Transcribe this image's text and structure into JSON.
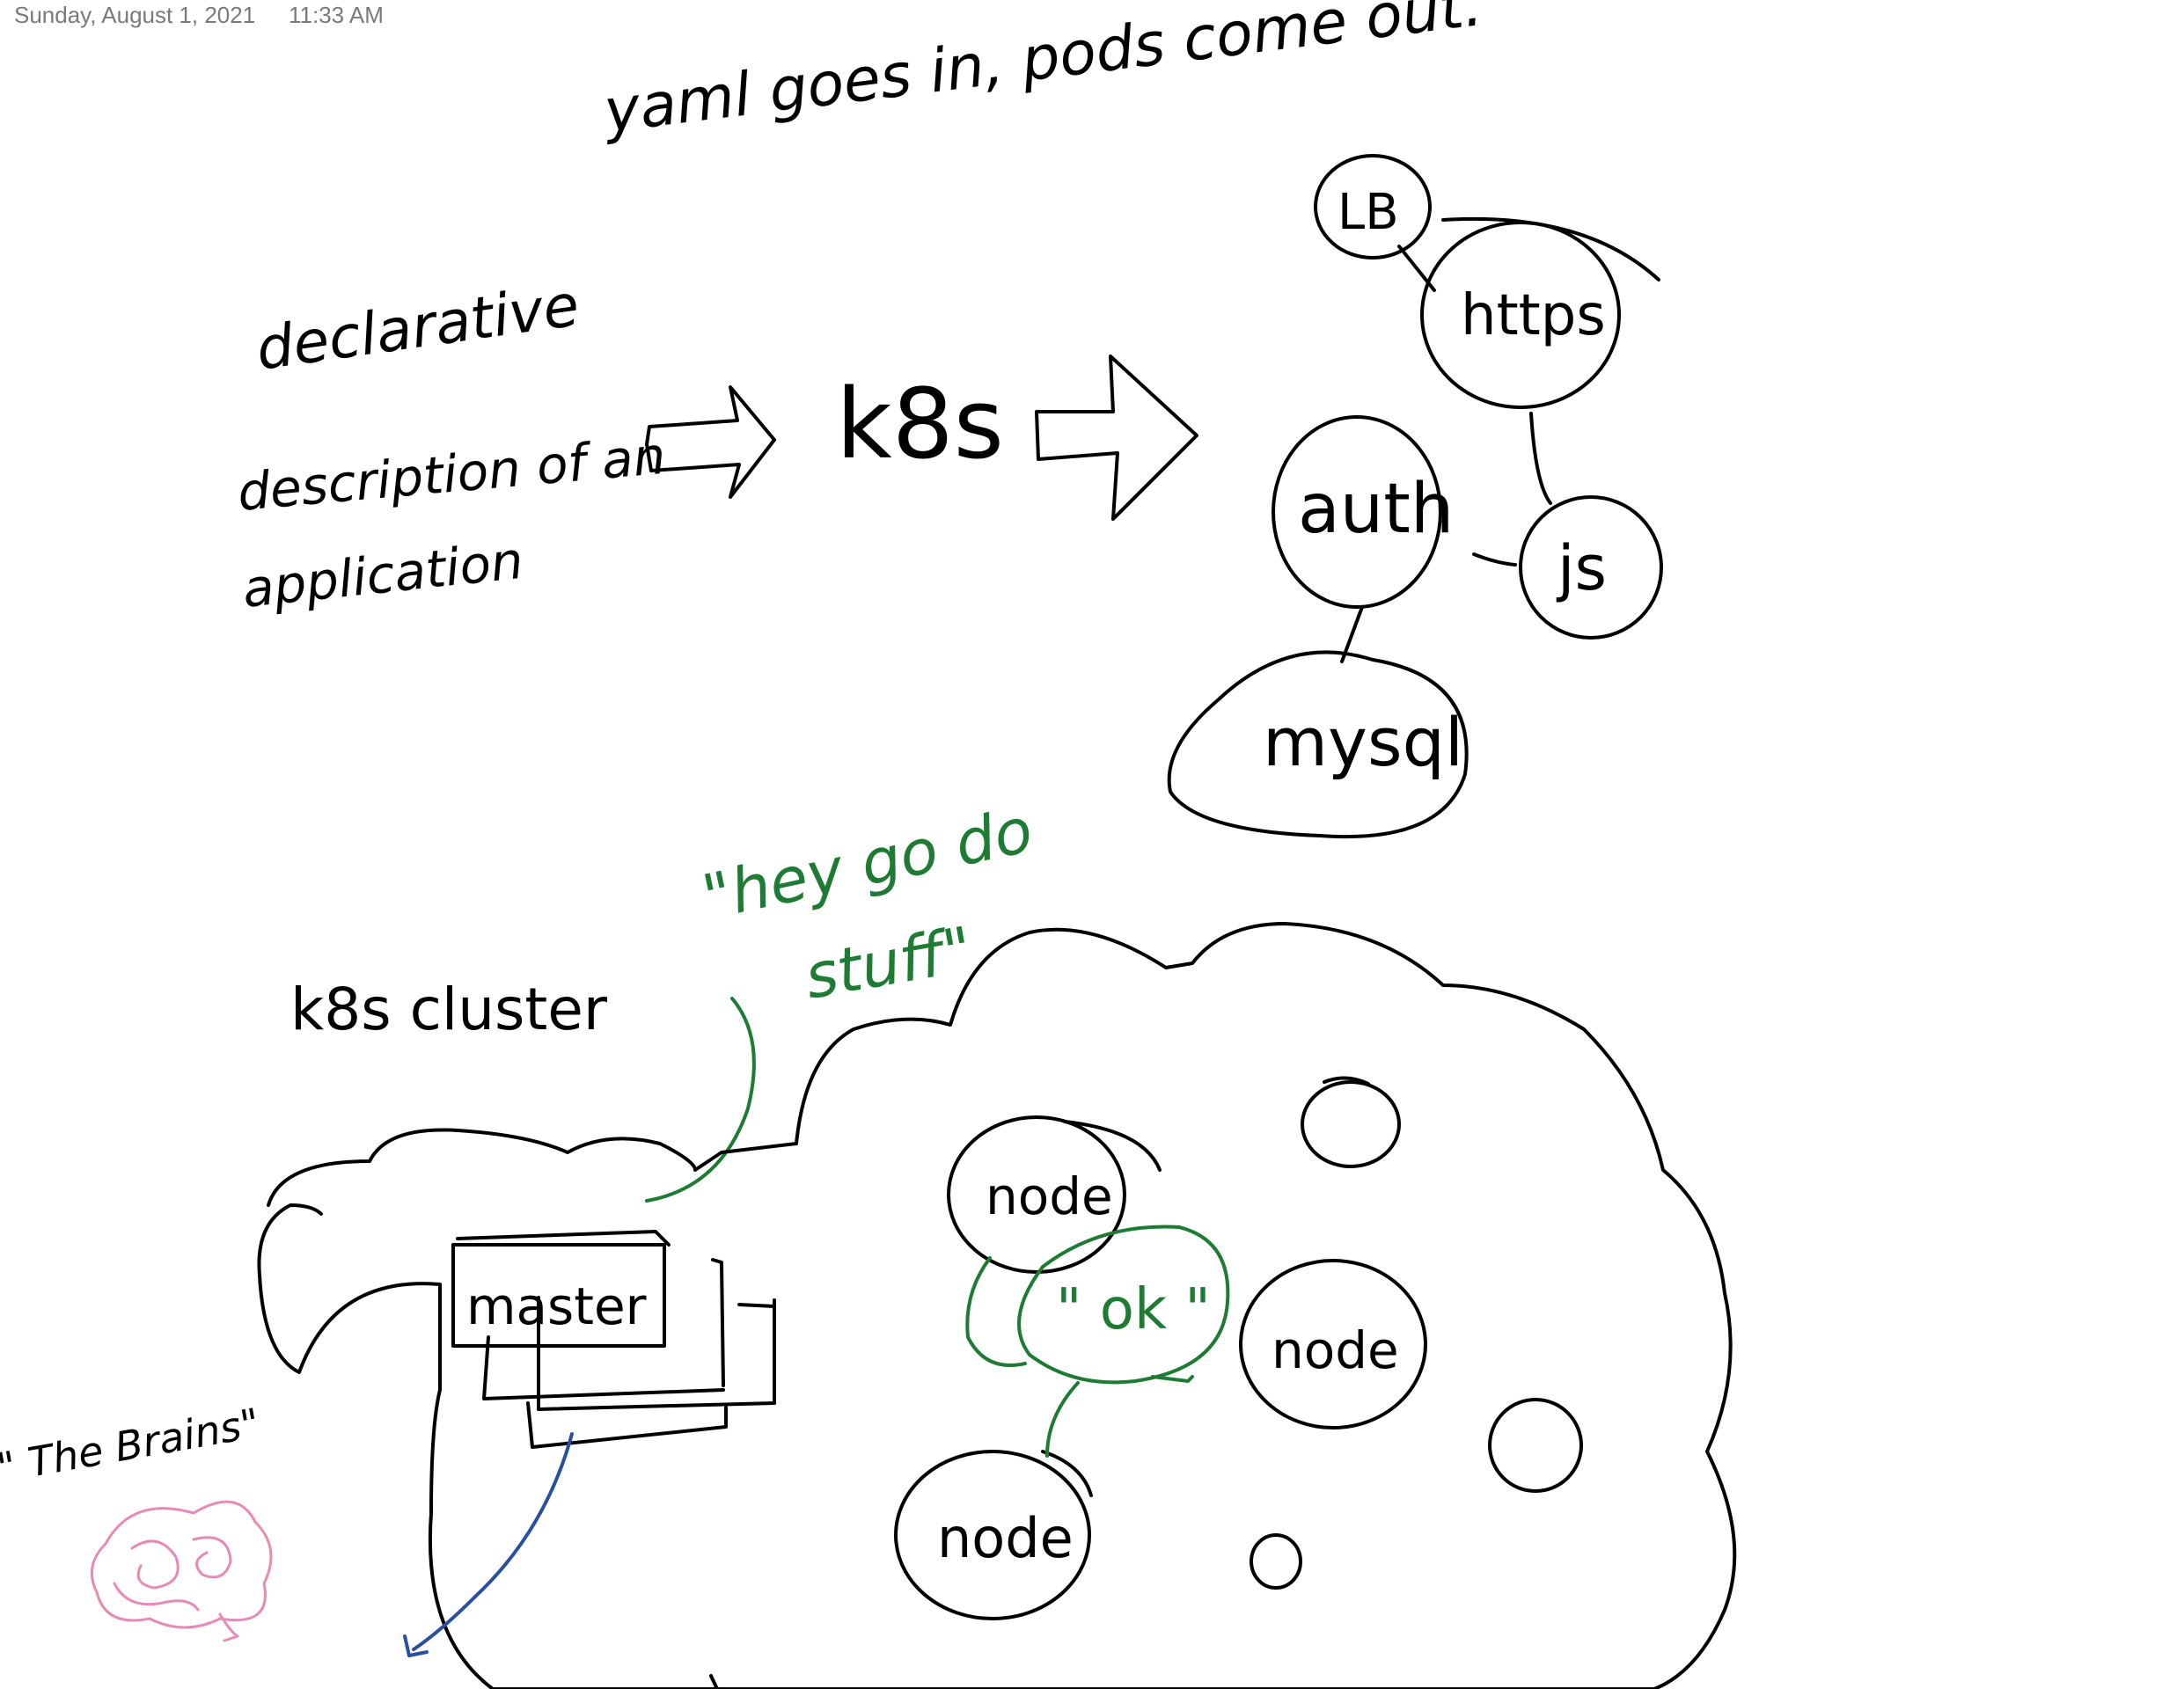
{
  "header": {
    "date": "Sunday, August 1, 2021",
    "time": "11:33 AM"
  },
  "notes": {
    "yaml_line": "yaml goes in, pods come out.",
    "declarative": "declarative",
    "description": "description of an",
    "application": "application",
    "k8s": "k8s",
    "cluster_label": "k8s cluster",
    "hey_line1": "\"hey go do",
    "hey_line2": "stuff\"",
    "brains": "\" The Brains\"",
    "master": "master",
    "ok": "\" ok \""
  },
  "pods": {
    "lb": "LB",
    "https": "https",
    "auth": "auth",
    "js": "js",
    "mysql": "mysql"
  },
  "nodes": {
    "node1": "node",
    "node2": "node",
    "node3": "node"
  },
  "colors": {
    "ink": "#000000",
    "green": "#1e7b34",
    "blue": "#2a4fa0",
    "pink": "#e88bb4",
    "header": "#7a7a7a"
  }
}
